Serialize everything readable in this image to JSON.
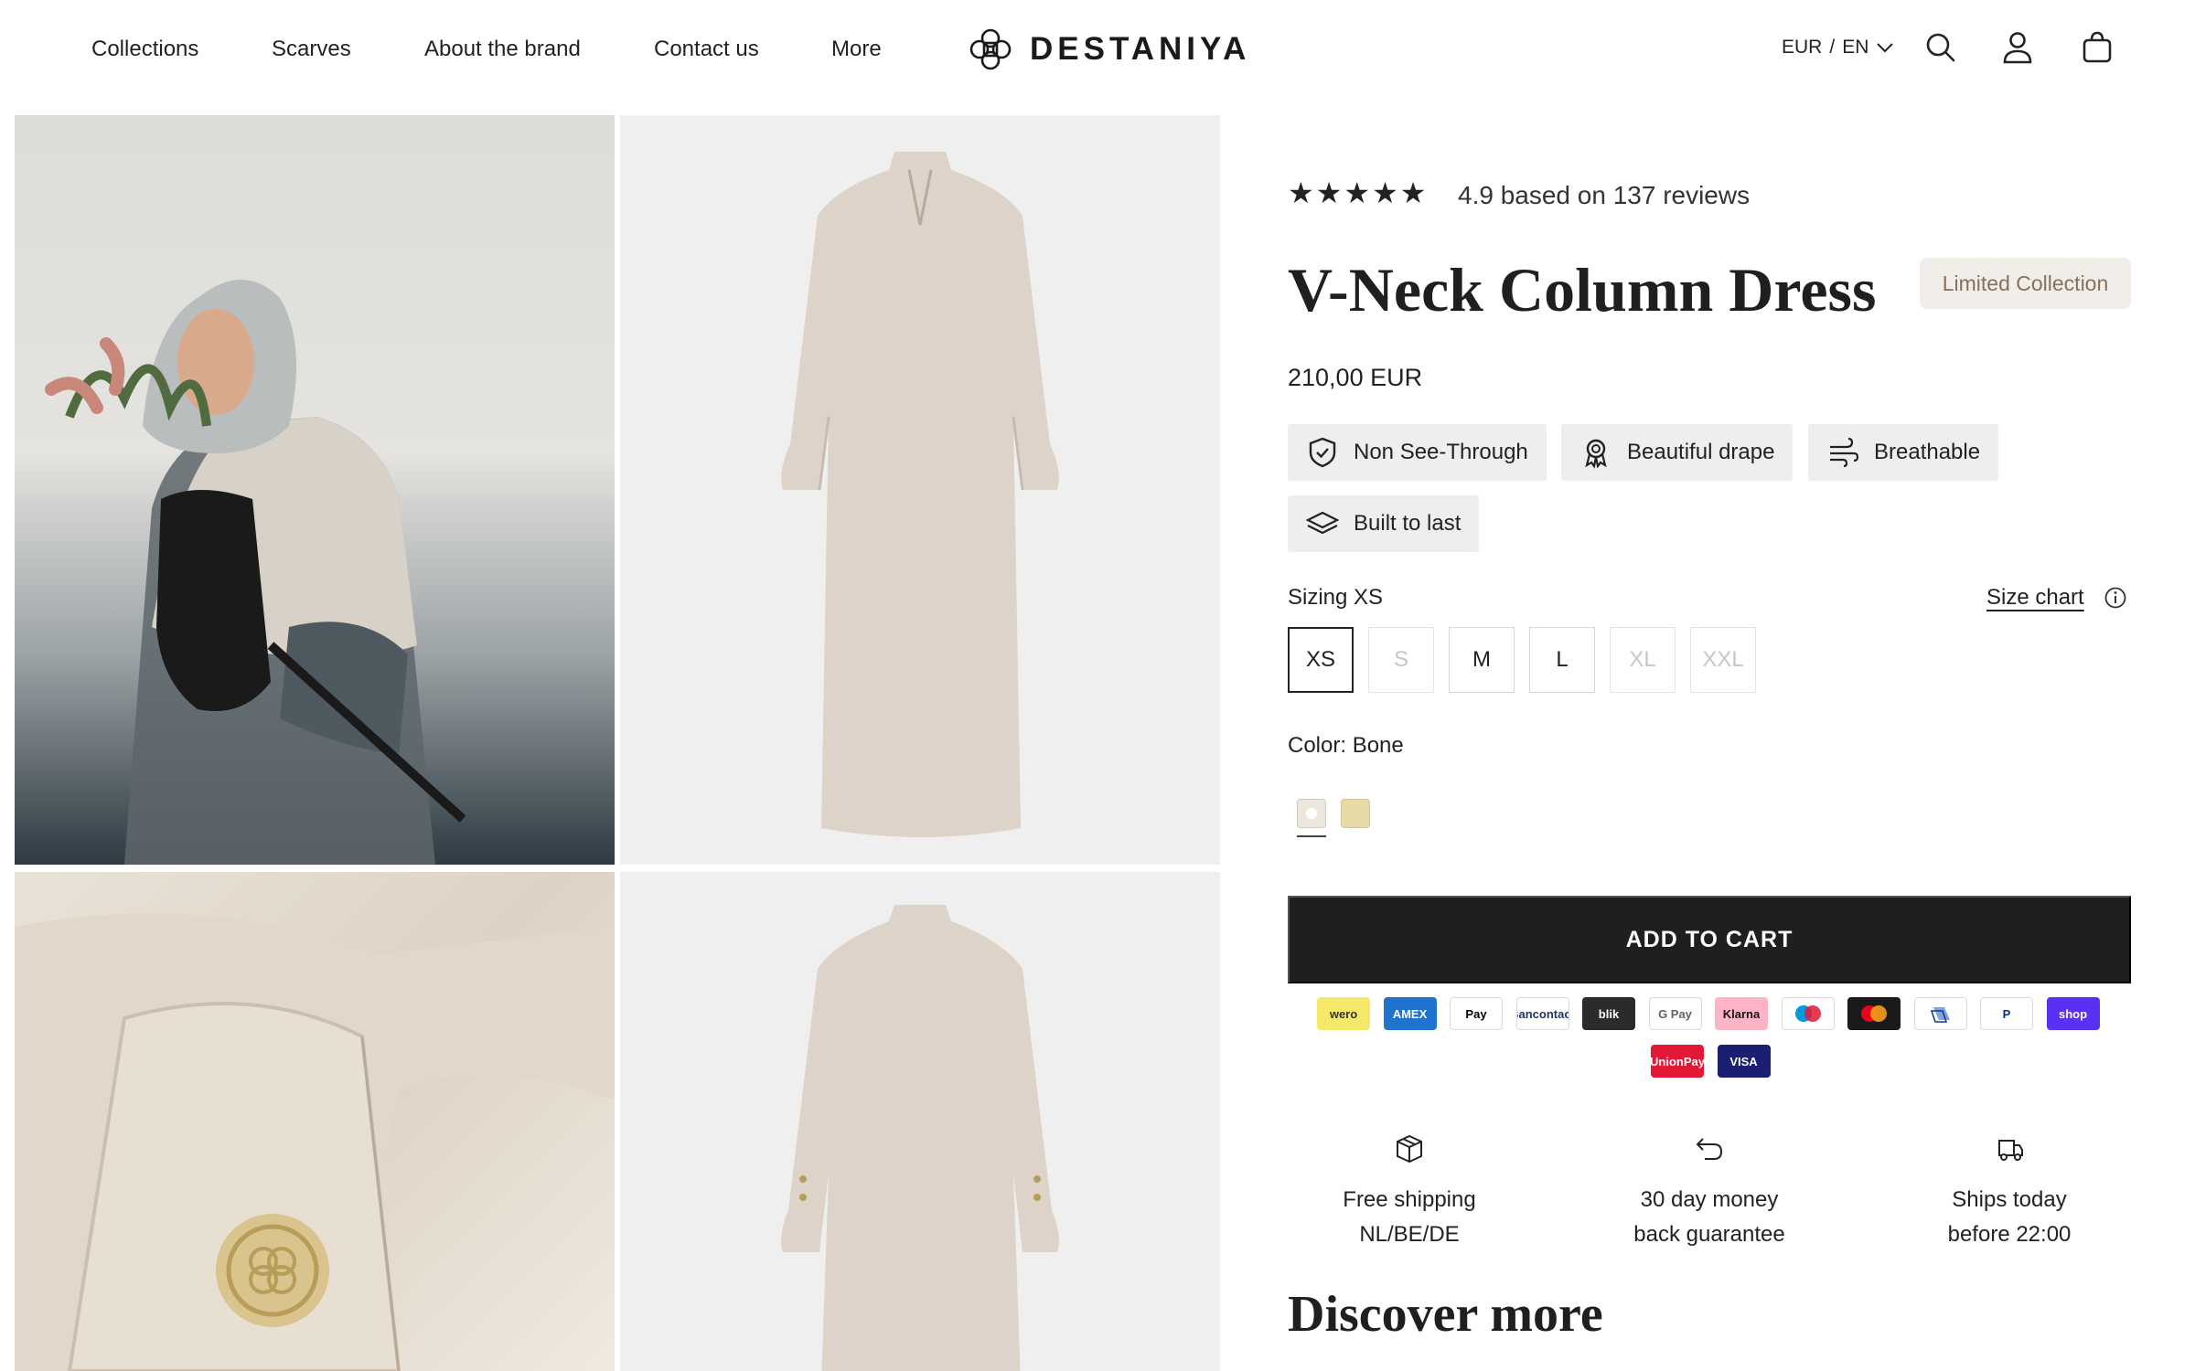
{
  "nav": {
    "items": [
      {
        "label": "Collections"
      },
      {
        "label": "Scarves"
      },
      {
        "label": "About the brand"
      },
      {
        "label": "Contact us"
      },
      {
        "label": "More"
      }
    ]
  },
  "brand": {
    "name": "DESTANIYA"
  },
  "locale": {
    "currency": "EUR",
    "separator": "/",
    "language": "EN"
  },
  "header_icons": [
    "search-icon",
    "account-icon",
    "cart-icon"
  ],
  "product": {
    "rating_stars": "★★★★★",
    "rating_text": "4.9 based on 137 reviews",
    "title": "V-Neck Column Dress",
    "badge": "Limited Collection",
    "price": "210,00 EUR",
    "features": [
      {
        "label": "Non See-Through",
        "icon": "shield-check-icon"
      },
      {
        "label": "Beautiful drape",
        "icon": "award-ribbon-icon"
      },
      {
        "label": "Breathable",
        "icon": "wind-icon"
      },
      {
        "label": "Built to last",
        "icon": "layers-icon"
      }
    ],
    "sizing_label": "Sizing XS",
    "size_chart_label": "Size chart",
    "sizes": [
      {
        "label": "XS",
        "state": "selected"
      },
      {
        "label": "S",
        "state": "unavailable"
      },
      {
        "label": "M",
        "state": "available"
      },
      {
        "label": "L",
        "state": "available"
      },
      {
        "label": "XL",
        "state": "unavailable"
      },
      {
        "label": "XXL",
        "state": "unavailable"
      }
    ],
    "color_label": "Color: Bone",
    "colors": [
      {
        "name": "Bone",
        "hex": "#ece6dc"
      },
      {
        "name": "Sand",
        "hex": "#e8d9a9"
      }
    ],
    "add_to_cart": "ADD TO CART"
  },
  "payments": [
    {
      "label": "wero",
      "bg": "#f6e96a",
      "fg": "#333"
    },
    {
      "label": "AMEX",
      "bg": "#1f72cd",
      "fg": "#fff"
    },
    {
      "label": "Pay",
      "bg": "#ffffff",
      "fg": "#000"
    },
    {
      "label": "Bancontact",
      "bg": "#ffffff",
      "fg": "#1e3764"
    },
    {
      "label": "blik",
      "bg": "#2b2b2b",
      "fg": "#fff"
    },
    {
      "label": "G Pay",
      "bg": "#ffffff",
      "fg": "#5f6368"
    },
    {
      "label": "Klarna",
      "bg": "#ffb3c7",
      "fg": "#17120f"
    },
    {
      "label": "",
      "bg": "#ffffff",
      "fg": "#000"
    },
    {
      "label": "",
      "bg": "#1a1a1a",
      "fg": "#fff"
    },
    {
      "label": "",
      "bg": "#ffffff",
      "fg": "#0a3a8c"
    },
    {
      "label": "P",
      "bg": "#ffffff",
      "fg": "#003087"
    },
    {
      "label": "shop",
      "bg": "#5a31f4",
      "fg": "#fff"
    },
    {
      "label": "UnionPay",
      "bg": "#e21836",
      "fg": "#fff"
    },
    {
      "label": "VISA",
      "bg": "#1a1f71",
      "fg": "#fff"
    }
  ],
  "perks": [
    {
      "line1": "Free shipping",
      "line2": "NL/BE/DE",
      "icon": "package-icon"
    },
    {
      "line1": "30 day money",
      "line2": "back guarantee",
      "icon": "return-arrow-icon"
    },
    {
      "line1": "Ships today",
      "line2": "before 22:00",
      "icon": "truck-icon"
    }
  ],
  "discover_title": "Discover more"
}
